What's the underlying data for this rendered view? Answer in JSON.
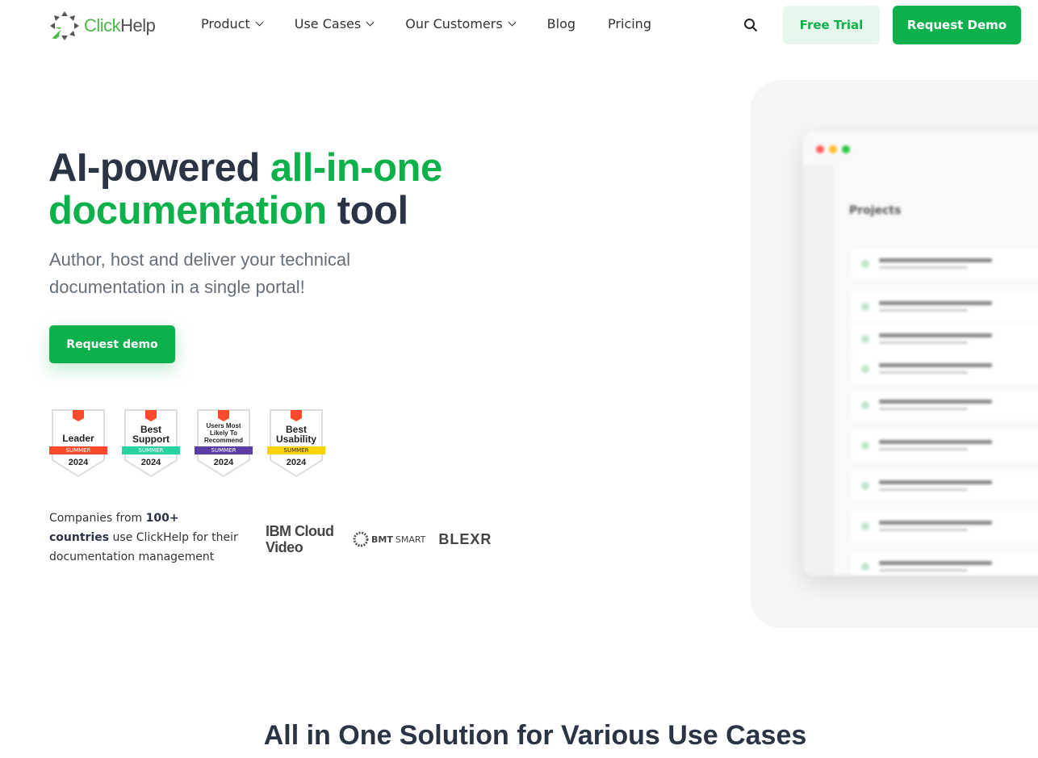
{
  "brand": {
    "name_part1": "Click",
    "name_part2": "Help",
    "accent": "#0db14b"
  },
  "nav": {
    "items": [
      {
        "label": "Product",
        "dropdown": true
      },
      {
        "label": "Use Cases",
        "dropdown": true
      },
      {
        "label": "Our Customers",
        "dropdown": true
      },
      {
        "label": "Blog",
        "dropdown": false
      },
      {
        "label": "Pricing",
        "dropdown": false
      }
    ],
    "search_icon": "search-icon",
    "free_trial": "Free Trial",
    "request_demo": "Request Demo"
  },
  "hero": {
    "title_a": "AI-powered ",
    "title_b": "all-in-one documentation",
    "title_c": " tool",
    "subtitle": "Author, host and deliver your technical documentation in a single portal!",
    "cta": "Request demo"
  },
  "badges": [
    {
      "title": "Leader",
      "season": "SUMMER",
      "year": "2024",
      "color": "#ff492c"
    },
    {
      "title": "Best Support",
      "season": "SUMMER",
      "year": "2024",
      "color": "#27d3a5"
    },
    {
      "title": "Users Most Likely To Recommend",
      "season": "SUMMER",
      "year": "2024",
      "color": "#5c3ca5"
    },
    {
      "title": "Best Usability",
      "season": "SUMMER",
      "year": "2024",
      "color": "#ffd200"
    }
  ],
  "companies": {
    "t1": "Companies from ",
    "b1": "100+",
    "b2": "countries",
    "t2": " use ClickHelp for their documentation management"
  },
  "customer_logos": {
    "ibm": "IBM Cloud Video",
    "bmt_a": "BMT",
    "bmt_b": "SMART",
    "blexr": "BLEXR"
  },
  "mockup": {
    "title": "Projects"
  },
  "section": {
    "title": "All in One Solution for Various Use Cases"
  }
}
